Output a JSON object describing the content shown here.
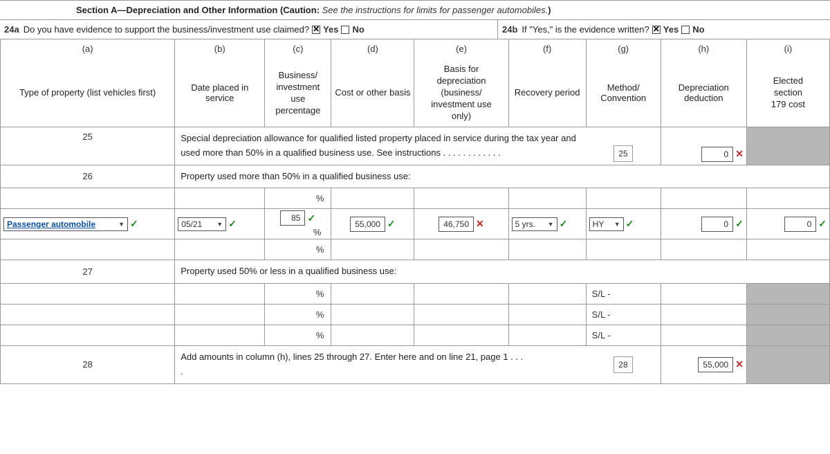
{
  "section": {
    "title_bold": "Section A—Depreciation and Other Information (Caution:",
    "title_italic": " See the instructions for limits for passenger automobiles.",
    "title_close": ")"
  },
  "q24a": {
    "num": "24a",
    "text": "Do you have evidence to support the business/investment use claimed?",
    "yes": "Yes",
    "no": "No"
  },
  "q24b": {
    "num": "24b",
    "text": "If \"Yes,\" is the evidence written?",
    "yes": "Yes",
    "no": "No"
  },
  "cols": {
    "a": "(a)",
    "b": "(b)",
    "c": "(c)",
    "d": "(d)",
    "e": "(e)",
    "f": "(f)",
    "g": "(g)",
    "h": "(h)",
    "i": "(i)",
    "a_lbl": "Type of property (list vehicles first)",
    "b_lbl": "Date placed in service",
    "c_lbl1": "Business/",
    "c_lbl2": "investment",
    "c_lbl3": "use",
    "c_lbl4": "percentage",
    "d_lbl": "Cost or other basis",
    "e_lbl1": "Basis for",
    "e_lbl2": "depreciation",
    "e_lbl3": "(business/",
    "e_lbl4": "investment use",
    "e_lbl5": "only)",
    "f_lbl": "Recovery period",
    "g_lbl": "Method/ Convention",
    "h_lbl": "Depreciation deduction",
    "i_lbl1": "Elected",
    "i_lbl2": "section",
    "i_lbl3": "179 cost"
  },
  "line25": {
    "num": "25",
    "text": "Special depreciation allowance for qualified listed property placed in service during the tax year and used more than 50% in a qualified business use. See instructions . . . . . . . . . . . .",
    "box": "25",
    "val": "0"
  },
  "line26": {
    "num": "26",
    "text": "Property used more than 50% in a qualified business use:"
  },
  "row1": {
    "type": "Passenger automobile",
    "date": "05/21",
    "pct": "85",
    "cost": "55,000",
    "basis": "46,750",
    "recovery": "5 yrs.",
    "method": "HY",
    "dep": "0",
    "s179": "0"
  },
  "line27": {
    "num": "27",
    "text": "Property used 50% or less in a qualified business use:"
  },
  "sl": "S/L -",
  "line28": {
    "num": "28",
    "text": "Add amounts in column (h), lines 25 through 27. Enter here and on line 21, page 1 . . .",
    "dot": ".",
    "box": "28",
    "val": "55,000"
  },
  "pct": "%"
}
